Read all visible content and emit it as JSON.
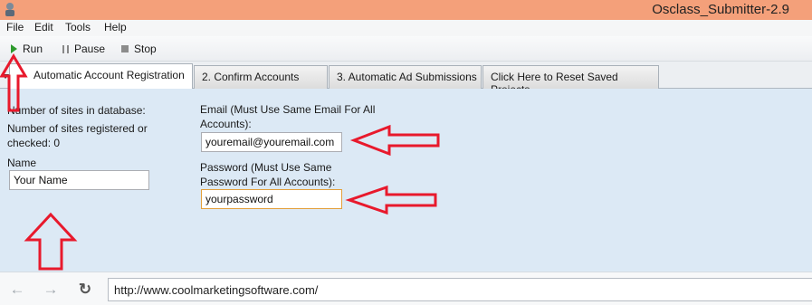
{
  "window": {
    "title": "Osclass_Submitter-2.9"
  },
  "menu": {
    "items": [
      "File",
      "Edit",
      "Tools",
      "Help"
    ]
  },
  "toolbar": {
    "run_label": "Run",
    "pause_label": "Pause",
    "stop_label": "Stop"
  },
  "tabs": [
    {
      "label": "Automatic Account Registration",
      "active": true
    },
    {
      "label": "2. Confirm Accounts",
      "active": false
    },
    {
      "label": "3. Automatic Ad Submissions",
      "active": false
    },
    {
      "label": "Click Here to Reset Saved Projects",
      "active": false
    }
  ],
  "form": {
    "sites_in_db_label": "Number of sites in database:",
    "sites_registered_label": "Number of sites registered or checked: 0",
    "name_label": "Name",
    "name_value": "Your Name",
    "email_label": "Email (Must Use Same Email For All Accounts):",
    "email_value": "youremail@youremail.com",
    "password_label": "Password (Must Use Same Password For All Accounts):",
    "password_value": "yourpassword"
  },
  "browser": {
    "url": "http://www.coolmarketingsoftware.com/"
  },
  "colors": {
    "titlebar": "#f4a07a",
    "panel": "#dce9f5",
    "annotation_arrow": "#e8192c",
    "run_icon": "#2d9a2d",
    "focus_border": "#e3a03b"
  },
  "icons": {
    "app": "app-icon",
    "run": "play-icon",
    "pause": "pause-icon",
    "stop": "stop-icon",
    "tab_menu": "dropdown-icon",
    "back": "back-arrow-icon",
    "forward": "forward-arrow-icon",
    "refresh": "refresh-icon"
  }
}
